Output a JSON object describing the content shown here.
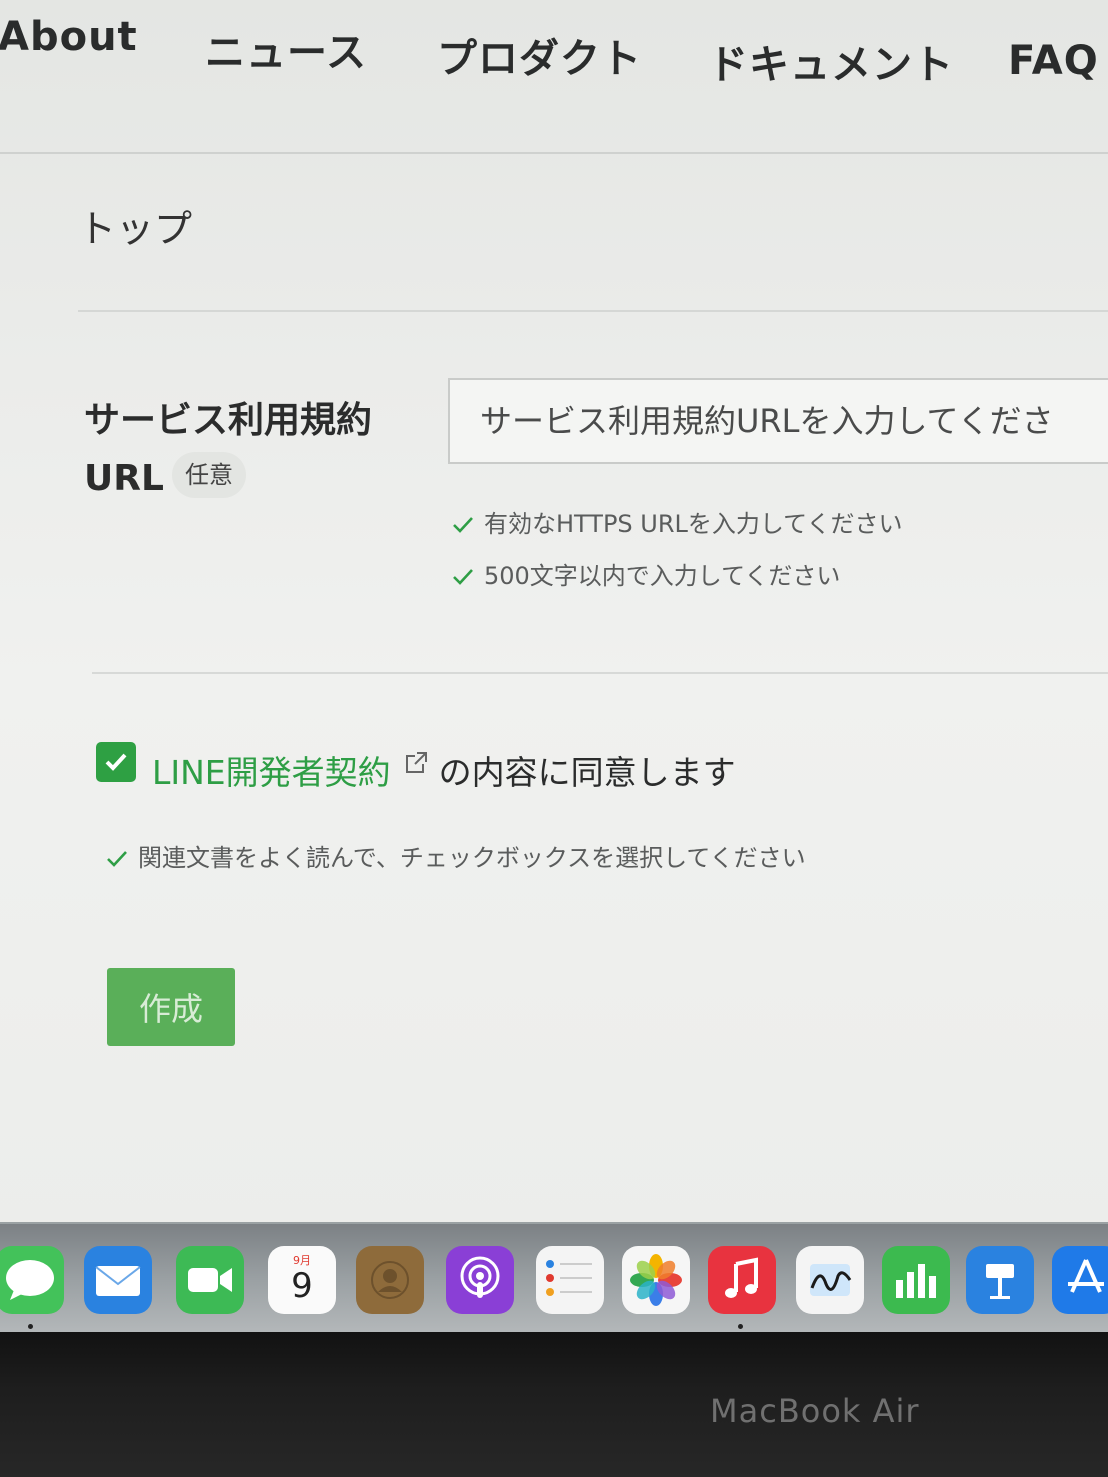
{
  "nav": {
    "items": [
      "About",
      "ニュース",
      "プロダクト",
      "ドキュメント",
      "FAQ"
    ]
  },
  "breadcrumb": "トップ",
  "form": {
    "terms_url": {
      "label_line1": "サービス利用規約",
      "label_line2": "URL",
      "optional_badge": "任意",
      "placeholder": "サービス利用規約URLを入力してくださ",
      "hints": [
        "有効なHTTPS URLを入力してください",
        "500文字以内で入力してください"
      ]
    },
    "agreement": {
      "checked": true,
      "link_text": "LINE開発者契約",
      "suffix_text": "の内容に同意します",
      "hint": "関連文書をよく読んで、チェックボックスを選択してください"
    },
    "submit_label": "作成"
  },
  "dock": {
    "calendar_month": "9月",
    "calendar_day": "9",
    "apps": [
      "messages-icon",
      "mail-icon",
      "facetime-icon",
      "calendar-icon",
      "contacts-icon",
      "podcasts-icon",
      "reminders-icon",
      "photos-icon",
      "music-icon",
      "freeform-icon",
      "numbers-icon",
      "keynote-icon",
      "app-store-icon"
    ]
  },
  "bezel_label": "MacBook Air",
  "colors": {
    "accent_green": "#2e9e45",
    "button_green": "#5aaf59"
  }
}
